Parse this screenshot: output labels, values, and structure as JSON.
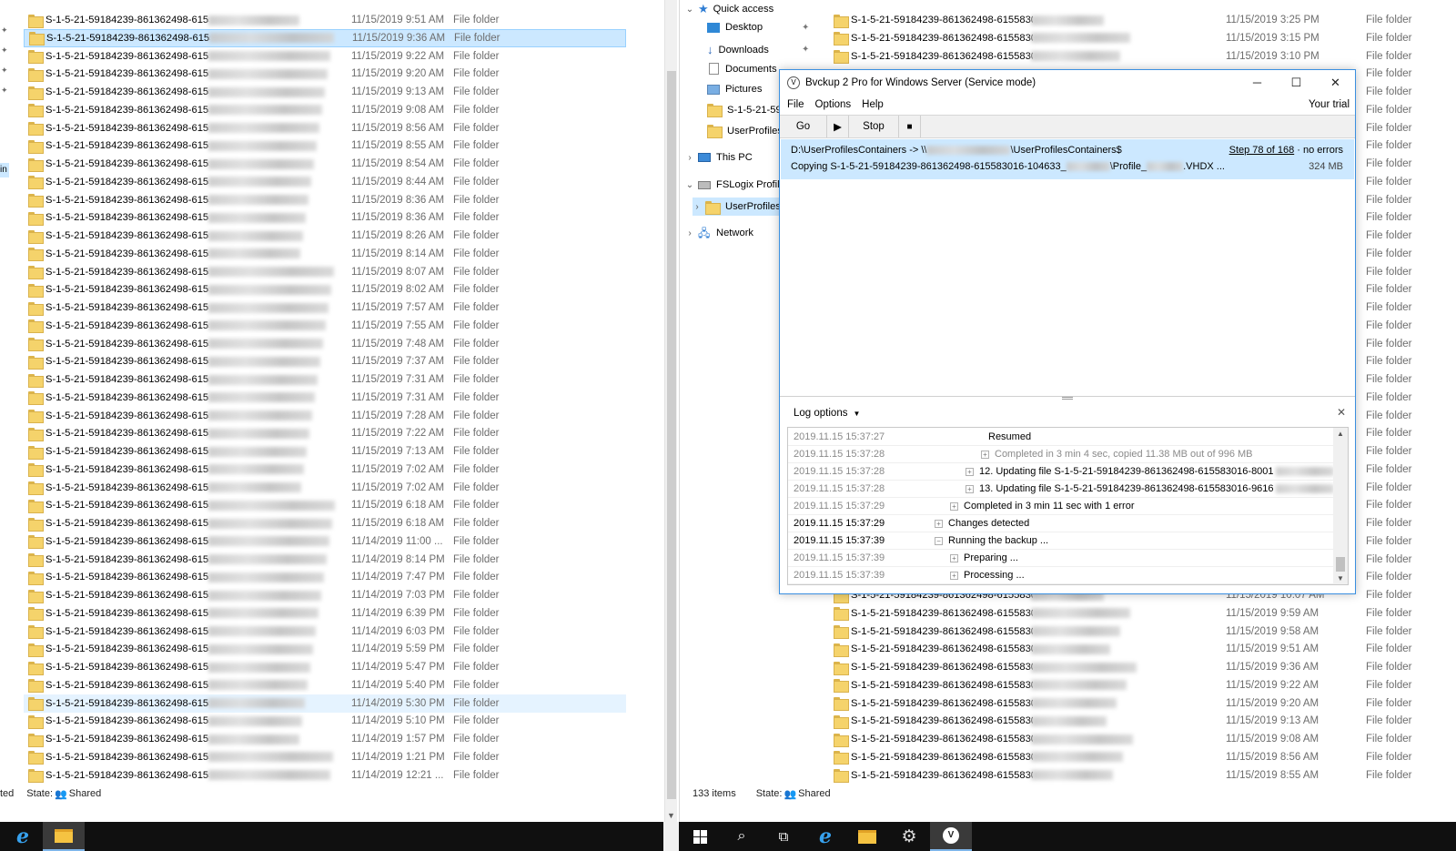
{
  "left_explorer": {
    "rows": [
      {
        "name": "S-1-5-21-59184239-861362498-6155",
        "date": "11/15/2019 9:51 AM",
        "type": "File folder"
      },
      {
        "name": "S-1-5-21-59184239-861362498-6155",
        "date": "11/15/2019 9:36 AM",
        "type": "File folder"
      },
      {
        "name": "S-1-5-21-59184239-861362498-6155",
        "date": "11/15/2019 9:22 AM",
        "type": "File folder"
      },
      {
        "name": "S-1-5-21-59184239-861362498-6155",
        "date": "11/15/2019 9:20 AM",
        "type": "File folder"
      },
      {
        "name": "S-1-5-21-59184239-861362498-6155",
        "date": "11/15/2019 9:13 AM",
        "type": "File folder"
      },
      {
        "name": "S-1-5-21-59184239-861362498-6155",
        "date": "11/15/2019 9:08 AM",
        "type": "File folder"
      },
      {
        "name": "S-1-5-21-59184239-861362498-6155",
        "date": "11/15/2019 8:56 AM",
        "type": "File folder"
      },
      {
        "name": "S-1-5-21-59184239-861362498-6155",
        "date": "11/15/2019 8:55 AM",
        "type": "File folder"
      },
      {
        "name": "S-1-5-21-59184239-861362498-6155",
        "date": "11/15/2019 8:54 AM",
        "type": "File folder"
      },
      {
        "name": "S-1-5-21-59184239-861362498-6155",
        "date": "11/15/2019 8:44 AM",
        "type": "File folder"
      },
      {
        "name": "S-1-5-21-59184239-861362498-6155",
        "date": "11/15/2019 8:36 AM",
        "type": "File folder"
      },
      {
        "name": "S-1-5-21-59184239-861362498-6155",
        "date": "11/15/2019 8:36 AM",
        "type": "File folder"
      },
      {
        "name": "S-1-5-21-59184239-861362498-6155",
        "date": "11/15/2019 8:26 AM",
        "type": "File folder"
      },
      {
        "name": "S-1-5-21-59184239-861362498-6155",
        "date": "11/15/2019 8:14 AM",
        "type": "File folder"
      },
      {
        "name": "S-1-5-21-59184239-861362498-6155",
        "date": "11/15/2019 8:07 AM",
        "type": "File folder"
      },
      {
        "name": "S-1-5-21-59184239-861362498-6155",
        "date": "11/15/2019 8:02 AM",
        "type": "File folder"
      },
      {
        "name": "S-1-5-21-59184239-861362498-6155",
        "date": "11/15/2019 7:57 AM",
        "type": "File folder"
      },
      {
        "name": "S-1-5-21-59184239-861362498-6155",
        "date": "11/15/2019 7:55 AM",
        "type": "File folder"
      },
      {
        "name": "S-1-5-21-59184239-861362498-6155",
        "date": "11/15/2019 7:48 AM",
        "type": "File folder"
      },
      {
        "name": "S-1-5-21-59184239-861362498-6155",
        "date": "11/15/2019 7:37 AM",
        "type": "File folder"
      },
      {
        "name": "S-1-5-21-59184239-861362498-6155",
        "date": "11/15/2019 7:31 AM",
        "type": "File folder"
      },
      {
        "name": "S-1-5-21-59184239-861362498-6155",
        "date": "11/15/2019 7:31 AM",
        "type": "File folder"
      },
      {
        "name": "S-1-5-21-59184239-861362498-6155",
        "date": "11/15/2019 7:28 AM",
        "type": "File folder"
      },
      {
        "name": "S-1-5-21-59184239-861362498-6155",
        "date": "11/15/2019 7:22 AM",
        "type": "File folder"
      },
      {
        "name": "S-1-5-21-59184239-861362498-6155",
        "date": "11/15/2019 7:13 AM",
        "type": "File folder"
      },
      {
        "name": "S-1-5-21-59184239-861362498-6155",
        "date": "11/15/2019 7:02 AM",
        "type": "File folder"
      },
      {
        "name": "S-1-5-21-59184239-861362498-6155",
        "date": "11/15/2019 7:02 AM",
        "type": "File folder"
      },
      {
        "name": "S-1-5-21-59184239-861362498-6155",
        "date": "11/15/2019 6:18 AM",
        "type": "File folder"
      },
      {
        "name": "S-1-5-21-59184239-861362498-6155",
        "date": "11/15/2019 6:18 AM",
        "type": "File folder"
      },
      {
        "name": "S-1-5-21-59184239-861362498-6155",
        "date": "11/14/2019 11:00 ...",
        "type": "File folder"
      },
      {
        "name": "S-1-5-21-59184239-861362498-6155",
        "date": "11/14/2019 8:14 PM",
        "type": "File folder"
      },
      {
        "name": "S-1-5-21-59184239-861362498-6155",
        "date": "11/14/2019 7:47 PM",
        "type": "File folder"
      },
      {
        "name": "S-1-5-21-59184239-861362498-6155",
        "date": "11/14/2019 7:03 PM",
        "type": "File folder"
      },
      {
        "name": "S-1-5-21-59184239-861362498-6155",
        "date": "11/14/2019 6:39 PM",
        "type": "File folder"
      },
      {
        "name": "S-1-5-21-59184239-861362498-6155",
        "date": "11/14/2019 6:03 PM",
        "type": "File folder"
      },
      {
        "name": "S-1-5-21-59184239-861362498-6155",
        "date": "11/14/2019 5:59 PM",
        "type": "File folder"
      },
      {
        "name": "S-1-5-21-59184239-861362498-6155",
        "date": "11/14/2019 5:47 PM",
        "type": "File folder"
      },
      {
        "name": "S-1-5-21-59184239-861362498-6155",
        "date": "11/14/2019 5:40 PM",
        "type": "File folder"
      },
      {
        "name": "S-1-5-21-59184239-861362498-6155",
        "date": "11/14/2019 5:30 PM",
        "type": "File folder"
      },
      {
        "name": "S-1-5-21-59184239-861362498-6155",
        "date": "11/14/2019 5:10 PM",
        "type": "File folder"
      },
      {
        "name": "S-1-5-21-59184239-861362498-6155",
        "date": "11/14/2019 1:57 PM",
        "type": "File folder"
      },
      {
        "name": "S-1-5-21-59184239-861362498-6155",
        "date": "11/14/2019 1:21 PM",
        "type": "File folder"
      },
      {
        "name": "S-1-5-21-59184239-861362498-6155",
        "date": "11/14/2019 12:21 ...",
        "type": "File folder"
      }
    ],
    "selected_index": 1,
    "hover_index": 38,
    "nav_fragment": "in",
    "status": {
      "prefix": "ted",
      "state_label": "State:",
      "state_value": "Shared"
    }
  },
  "right_explorer": {
    "nav": {
      "quick_access": "Quick access",
      "desktop": "Desktop",
      "downloads": "Downloads",
      "documents": "Documents",
      "pictures": "Pictures",
      "sid_folder": "S-1-5-21-59",
      "userprofiles": "UserProfiles",
      "this_pc": "This PC",
      "fslogix": "FSLogix Profil",
      "userprofiles_sub": "UserProfiles",
      "network": "Network"
    },
    "rows_top": [
      {
        "name": "S-1-5-21-59184239-861362498-61558301",
        "date": "11/15/2019 3:25 PM",
        "type": "File folder"
      },
      {
        "name": "S-1-5-21-59184239-861362498-61558301",
        "date": "11/15/2019 3:15 PM",
        "type": "File folder"
      },
      {
        "name": "S-1-5-21-59184239-861362498-61558301",
        "date": "11/15/2019 3:10 PM",
        "type": "File folder"
      }
    ],
    "type_only_count": 29,
    "type_only_label": "File folder",
    "rows_bottom": [
      {
        "name": "S-1-5-21-59184239-861362498-61558301",
        "date": "11/15/2019 10:07 AM",
        "type": "File folder"
      },
      {
        "name": "S-1-5-21-59184239-861362498-61558301",
        "date": "11/15/2019 9:59 AM",
        "type": "File folder"
      },
      {
        "name": "S-1-5-21-59184239-861362498-61558301",
        "date": "11/15/2019 9:58 AM",
        "type": "File folder"
      },
      {
        "name": "S-1-5-21-59184239-861362498-61558301",
        "date": "11/15/2019 9:51 AM",
        "type": "File folder"
      },
      {
        "name": "S-1-5-21-59184239-861362498-61558301",
        "date": "11/15/2019 9:36 AM",
        "type": "File folder"
      },
      {
        "name": "S-1-5-21-59184239-861362498-61558301",
        "date": "11/15/2019 9:22 AM",
        "type": "File folder"
      },
      {
        "name": "S-1-5-21-59184239-861362498-61558301",
        "date": "11/15/2019 9:20 AM",
        "type": "File folder"
      },
      {
        "name": "S-1-5-21-59184239-861362498-61558301",
        "date": "11/15/2019 9:13 AM",
        "type": "File folder"
      },
      {
        "name": "S-1-5-21-59184239-861362498-61558301",
        "date": "11/15/2019 9:08 AM",
        "type": "File folder"
      },
      {
        "name": "S-1-5-21-59184239-861362498-61558301",
        "date": "11/15/2019 8:56 AM",
        "type": "File folder"
      },
      {
        "name": "S-1-5-21-59184239-861362498-61558301",
        "date": "11/15/2019 8:55 AM",
        "type": "File folder"
      }
    ],
    "status": {
      "items": "133 items",
      "state_label": "State:",
      "state_value": "Shared"
    }
  },
  "bvckup": {
    "title": "Bvckup 2 Pro for Windows Server (Service mode)",
    "logo": "V",
    "menu": [
      "File",
      "Options",
      "Help"
    ],
    "trial": "Your trial",
    "toolbar": {
      "go": "Go",
      "stop": "Stop"
    },
    "job": {
      "line1": "D:\\UserProfilesContainers -> \\\\",
      "line1_tail": "\\UserProfilesContainers$",
      "line2": "Copying S-1-5-21-59184239-861362498-615583016-104633_",
      "line2_mid": "\\Profile_",
      "line2_tail": ".VHDX  ...",
      "step": "Step 78 of 168",
      "errors": "·  no errors",
      "size": "324 MB"
    },
    "log_options": "Log options",
    "log": [
      {
        "ts": "2019.11.15 15:37:27",
        "text": "Resumed",
        "indent": 220,
        "dim": false,
        "box": ""
      },
      {
        "ts": "2019.11.15 15:37:28",
        "text": "Completed in 3 min 4 sec, copied 11.38 MB out of 996 MB",
        "indent": 212,
        "dim": true,
        "box": "+"
      },
      {
        "ts": "2019.11.15 15:37:28",
        "text": "12. Updating file S-1-5-21-59184239-861362498-615583016-8001",
        "indent": 195,
        "dim": false,
        "box": "+"
      },
      {
        "ts": "2019.11.15 15:37:28",
        "text": "13. Updating file S-1-5-21-59184239-861362498-615583016-9616",
        "indent": 195,
        "dim": false,
        "box": "+"
      },
      {
        "ts": "2019.11.15 15:37:29",
        "text": "Completed in 3 min 11 sec with 1 error",
        "indent": 178,
        "dim": false,
        "box": "+"
      },
      {
        "ts": "2019.11.15 15:37:29",
        "text": "Changes detected",
        "indent": 161,
        "dim": false,
        "box": "+"
      },
      {
        "ts": "2019.11.15 15:37:39",
        "text": "Running the backup ...",
        "indent": 161,
        "dim": false,
        "box": "−"
      },
      {
        "ts": "2019.11.15 15:37:39",
        "text": "Preparing ...",
        "indent": 178,
        "dim": false,
        "box": "+"
      },
      {
        "ts": "2019.11.15 15:37:39",
        "text": "Processing ...",
        "indent": 178,
        "dim": false,
        "box": "+"
      }
    ]
  },
  "taskbar": {
    "left": [
      "ie-icon",
      "file-explorer-icon"
    ],
    "right": [
      "start-icon",
      "search-icon",
      "task-view-icon",
      "ie-icon",
      "file-explorer-icon",
      "settings-icon",
      "bvckup-icon"
    ]
  }
}
